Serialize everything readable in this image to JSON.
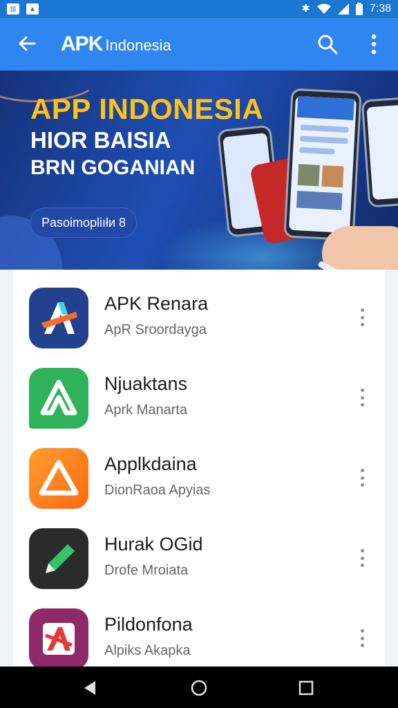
{
  "status_bar": {
    "time": "7:38",
    "left_icons": [
      "notification-icon",
      "image-icon"
    ],
    "right_icons": [
      "bluetooth-icon",
      "wifi-icon",
      "signal-icon",
      "battery-icon"
    ]
  },
  "app_bar": {
    "logo_apk": "APK",
    "logo_text": "Indonesia",
    "back_icon": "arrow-back-icon",
    "search_icon": "search-icon",
    "more_icon": "more-vert-icon"
  },
  "banner": {
    "title": "APP INDONESIA",
    "line1": "HIOR BAISIA",
    "line2": "BRN GOGANIAN",
    "button": "Pasoimopliıłи 8"
  },
  "apps": [
    {
      "name": "APK Renara",
      "developer": "ApR Sroordayga",
      "icon": "apk-a-logo-icon",
      "color": "#22418f"
    },
    {
      "name": "Njuaktans",
      "developer": "Aprk Manarta",
      "icon": "green-a-logo-icon",
      "color": "#2fb35a"
    },
    {
      "name": "Applkdaina",
      "developer": "DionRaoa Apyias",
      "icon": "orange-triangle-icon",
      "color": "#ff7a1a"
    },
    {
      "name": "Hurak OGid",
      "developer": "Drofe Mroiata",
      "icon": "green-pencil-icon",
      "color": "#2b2b2b"
    },
    {
      "name": "Pildonfona",
      "developer": "Alpiks Akapka",
      "icon": "red-a-logo-icon",
      "color": "#8e2a67"
    }
  ],
  "nav_bar": {
    "back": "nav-back-icon",
    "home": "nav-home-icon",
    "recents": "nav-recents-icon"
  }
}
